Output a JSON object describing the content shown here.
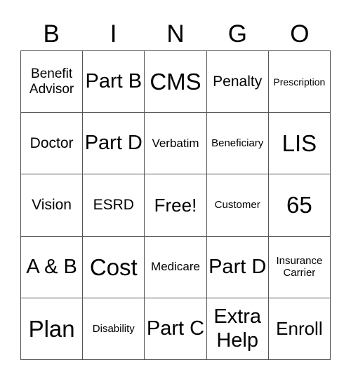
{
  "header": {
    "letters": [
      "B",
      "I",
      "N",
      "G",
      "O"
    ]
  },
  "board": {
    "rows": [
      [
        "Benefit Advisor",
        "Part B",
        "CMS",
        "Penalty",
        "Prescription"
      ],
      [
        "Doctor",
        "Part D",
        "Verbatim",
        "Beneficiary",
        "LIS"
      ],
      [
        "Vision",
        "ESRD",
        "Free!",
        "Customer",
        "65"
      ],
      [
        "A & B",
        "Cost",
        "Medicare",
        "Part D",
        "Insurance Carrier"
      ],
      [
        "Plan",
        "Disability",
        "Part C",
        "Extra Help",
        "Enroll"
      ]
    ],
    "free_space": "Free!"
  }
}
